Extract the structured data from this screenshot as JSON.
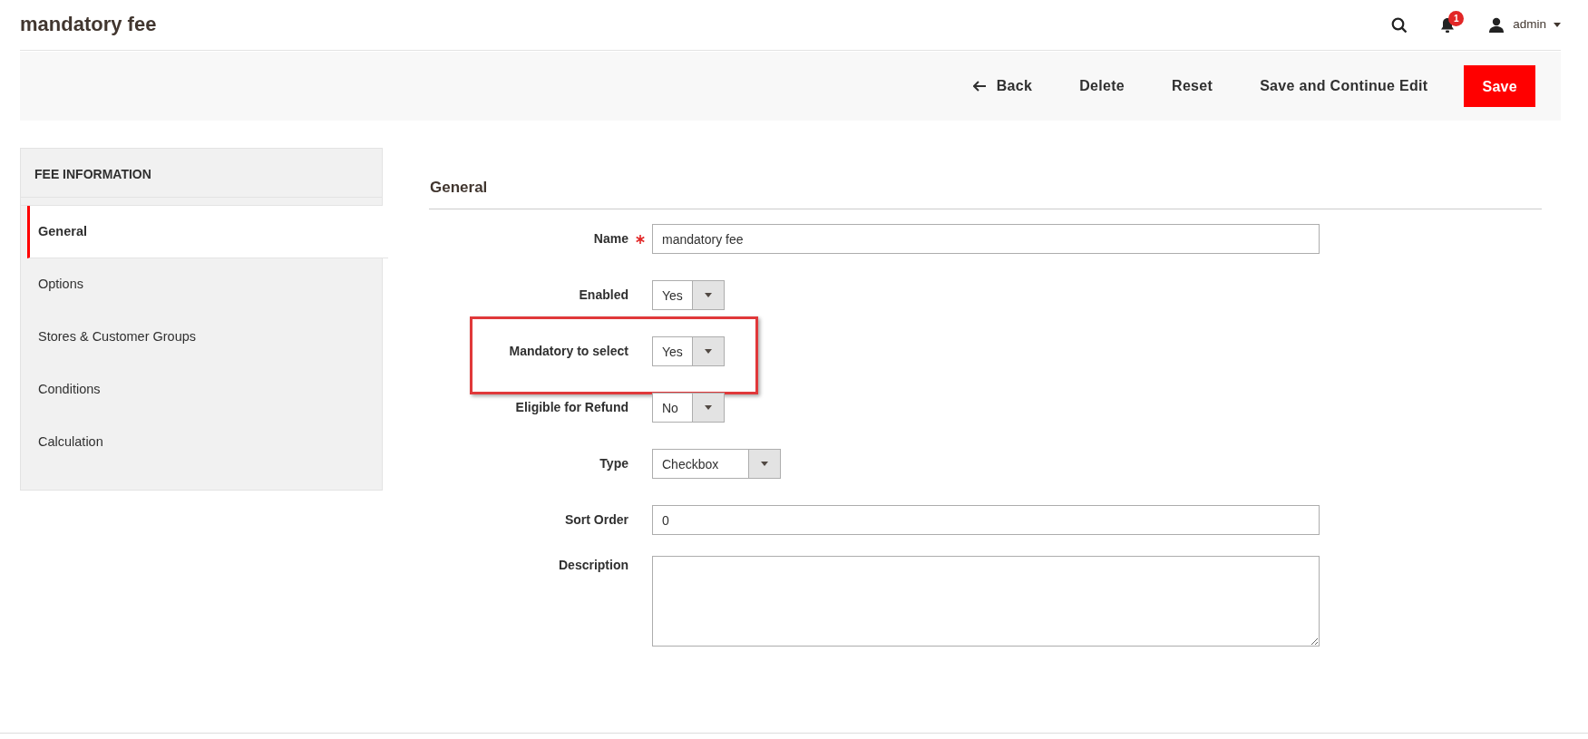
{
  "page_title": "mandatory fee",
  "header": {
    "notification_count": "1",
    "user": "admin"
  },
  "toolbar": [
    {
      "label": "Back",
      "kind": "back"
    },
    {
      "label": "Delete",
      "kind": "plain"
    },
    {
      "label": "Reset",
      "kind": "plain"
    },
    {
      "label": "Save and Continue Edit",
      "kind": "plain"
    },
    {
      "label": "Save",
      "kind": "primary"
    }
  ],
  "sidebar": {
    "title": "FEE INFORMATION",
    "items": [
      {
        "label": "General",
        "selected": true
      },
      {
        "label": "Options",
        "selected": false
      },
      {
        "label": "Stores & Customer Groups",
        "selected": false
      },
      {
        "label": "Conditions",
        "selected": false
      },
      {
        "label": "Calculation",
        "selected": false
      }
    ]
  },
  "section_title": "General",
  "fields": [
    {
      "label": "Name",
      "kind": "text",
      "value": "mandatory fee",
      "required": true,
      "highlighted": false
    },
    {
      "label": "Enabled",
      "kind": "select",
      "value": "Yes",
      "required": false,
      "highlighted": false
    },
    {
      "label": "Mandatory to select",
      "kind": "select",
      "value": "Yes",
      "required": false,
      "highlighted": true
    },
    {
      "label": "Eligible for Refund",
      "kind": "select",
      "value": "No",
      "required": false,
      "highlighted": false
    },
    {
      "label": "Type",
      "kind": "select_wide",
      "value": "Checkbox",
      "required": false,
      "highlighted": false
    },
    {
      "label": "Sort Order",
      "kind": "text",
      "value": "0",
      "required": false,
      "highlighted": false
    },
    {
      "label": "Description",
      "kind": "textarea",
      "required": false,
      "highlighted": false
    }
  ]
}
